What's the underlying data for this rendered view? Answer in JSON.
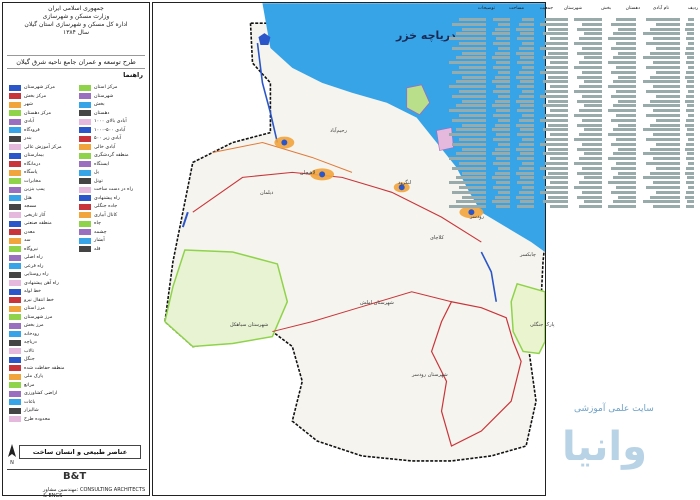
{
  "header": {
    "line1": "جمهوری اسلامی ایران",
    "line2": "وزارت مسکن و شهرسازی",
    "line3": "اداره کل مسکن و شهرسازی استان گیلان",
    "line4": "سال ۱۳۸۴"
  },
  "project_title": "طرح توسعه و عمران جامع ناحیه شرق گیلان",
  "guide_label": "راهنما",
  "sea_label": "دریاچه خزر",
  "map_labels": {
    "region_west": "شهرستان سیاهکل",
    "region_east": "شهرستان رودسر",
    "region_south": "شهرستان املش",
    "park_east": "پارک جنگلی",
    "area_1": "دیلمان",
    "area_2": "لنگرود",
    "area_3": "رودسر",
    "area_4": "چابکسر",
    "area_5": "کلاچای",
    "area_6": "لاهیجان",
    "area_7": "رحیم‌آباد"
  },
  "legend_items": [
    "مرکز شهرستان",
    "مرکز بخش",
    "شهر",
    "مرکز دهستان",
    "آبادی",
    "فرودگاه",
    "بندر",
    "مرکز آموزش عالی",
    "بیمارستان",
    "درمانگاه",
    "پاسگاه",
    "مخابرات",
    "پمپ بنزین",
    "هتل",
    "مسجد",
    "آثار تاریخی",
    "منطقه صنعتی",
    "معدن",
    "سد",
    "نیروگاه",
    "راه اصلی",
    "راه فرعی",
    "راه روستایی",
    "راه آهن پیشنهادی",
    "خط لوله",
    "خط انتقال نیرو",
    "مرز استان",
    "مرز شهرستان",
    "مرز بخش",
    "رودخانه",
    "دریاچه",
    "تالاب",
    "جنگل",
    "منطقه حفاظت شده",
    "پارک ملی",
    "مراتع",
    "اراضی کشاورزی",
    "باغات",
    "شالیزار",
    "محدوده طرح"
  ],
  "legend_right_items": [
    "مرکز استان",
    "شهرستان",
    "بخش",
    "دهستان",
    "آبادی بالای ۱۰۰۰",
    "آبادی ۵۰۰-۱۰۰۰",
    "آبادی زیر ۵۰۰",
    "آبادی خالی",
    "منطقه گردشگری",
    "ایستگاه",
    "پل",
    "تونل",
    "راه در دست ساخت",
    "راه پیشنهادی",
    "جاده جنگلی",
    "کانال آبیاری",
    "چاه",
    "چشمه",
    "آبشار",
    "قله"
  ],
  "map_title": "عناصر طبیعی و انسان ساخت",
  "firm_label": "مهندسین مشاور: CONSULTING ARCHITECTS & ENGS",
  "firm_logo": "B&T",
  "table_headers": [
    "ردیف",
    "نام آبادی",
    "دهستان",
    "بخش",
    "شهرستان",
    "جمعیت",
    "مساحت",
    "توضیحات"
  ],
  "watermark_small": "سایت علمی آموزشی",
  "watermark_big": "وانیا",
  "colors": {
    "sea": "#37a4e8",
    "border_province": "#111111",
    "road_main": "#c9343a",
    "river": "#2b56c9",
    "green_zone": "#8fd34a",
    "urban": "#f2a43c",
    "protected": "#6bbd3a"
  }
}
